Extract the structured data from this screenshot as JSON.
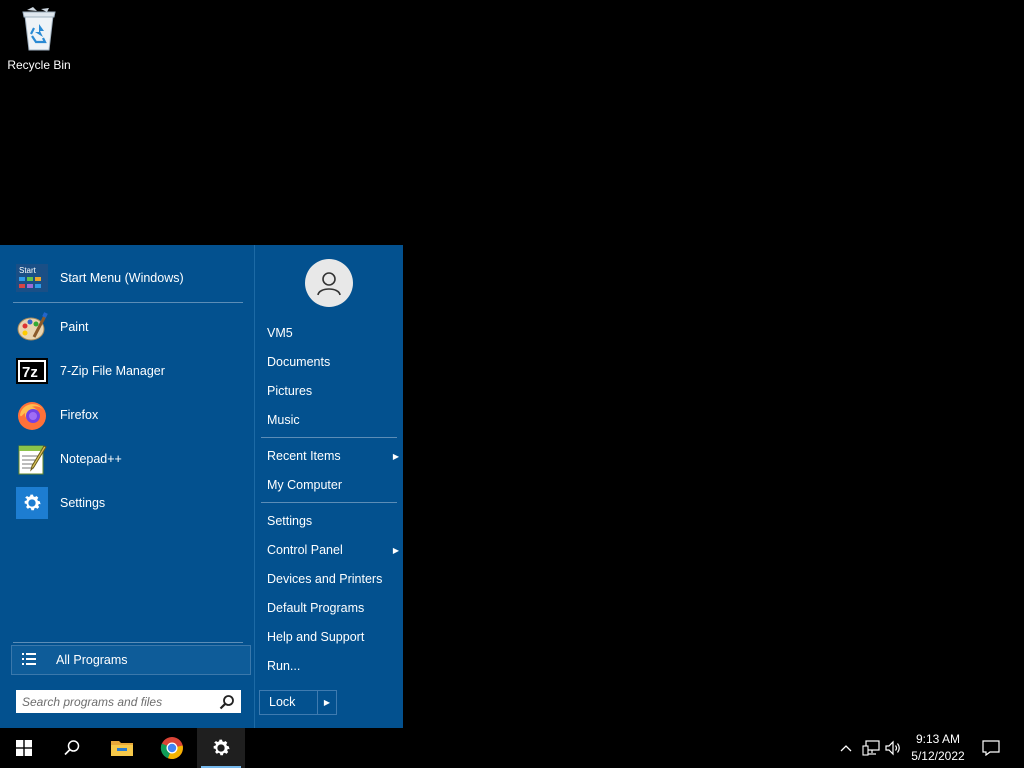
{
  "desktop": {
    "icons": [
      {
        "label": "Recycle Bin",
        "icon": "recycle-bin-icon"
      }
    ]
  },
  "start_menu": {
    "pinned": [
      {
        "label": "Start Menu (Windows)",
        "icon": "start-menu-icon",
        "icon_text": "Start"
      },
      {
        "label": "Paint",
        "icon": "paint-icon"
      },
      {
        "label": "7-Zip File Manager",
        "icon": "7zip-icon",
        "icon_text": "7z"
      },
      {
        "label": "Firefox",
        "icon": "firefox-icon"
      },
      {
        "label": "Notepad++",
        "icon": "notepad-plus-plus-icon"
      },
      {
        "label": "Settings",
        "icon": "gear-icon"
      }
    ],
    "all_programs": "All Programs",
    "search_placeholder": "Search programs and files",
    "right_items": [
      {
        "label": "VM5"
      },
      {
        "label": "Documents"
      },
      {
        "label": "Pictures"
      },
      {
        "label": "Music"
      },
      {
        "label": "Recent Items",
        "submenu": true
      },
      {
        "label": "My Computer"
      },
      {
        "label": "Settings"
      },
      {
        "label": "Control Panel",
        "submenu": true
      },
      {
        "label": "Devices and Printers"
      },
      {
        "label": "Default Programs"
      },
      {
        "label": "Help and Support"
      },
      {
        "label": "Run..."
      }
    ],
    "lock_label": "Lock",
    "arrow_glyph": "▶"
  },
  "taskbar": {
    "buttons": [
      "windows-start-icon",
      "search-icon",
      "file-explorer-icon",
      "chrome-icon",
      "settings-gear-icon"
    ],
    "active_button": "settings-gear-icon",
    "tray": [
      "chevron-up-icon",
      "network-icon",
      "volume-icon",
      "notification-icon"
    ],
    "time": "9:13 AM",
    "date": "5/12/2022"
  },
  "colors": {
    "menu_bg": "#03518f",
    "accent": "#76b9ed",
    "taskbar_bg": "#000000"
  }
}
